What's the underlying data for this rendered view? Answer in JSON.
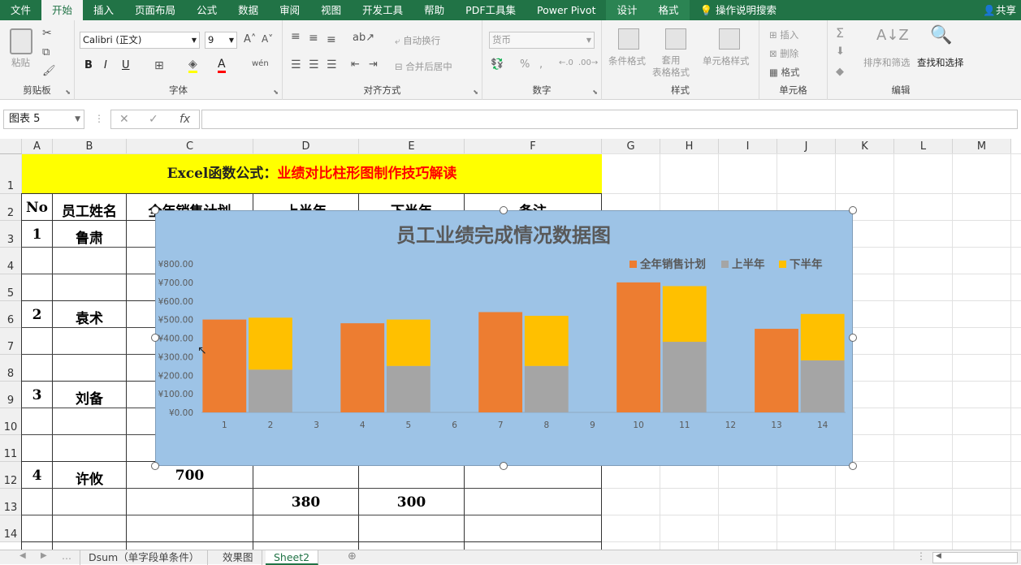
{
  "ribbon_tabs": [
    "文件",
    "开始",
    "插入",
    "页面布局",
    "公式",
    "数据",
    "审阅",
    "视图",
    "开发工具",
    "帮助",
    "PDF工具集",
    "Power Pivot",
    "设计",
    "格式",
    "操作说明搜索"
  ],
  "share": "共享",
  "ribbon": {
    "paste": "粘贴",
    "clipboard": "剪贴板",
    "font_name": "Calibri (正文)",
    "font_size": "9",
    "font_group": "字体",
    "wrap": "自动换行",
    "merge": "合并后居中",
    "align_group": "对齐方式",
    "number_format": "货币",
    "number_group": "数字",
    "cond_format": "条件格式",
    "table_format": "套用\n表格格式",
    "cell_style": "单元格样式",
    "style_group": "样式",
    "insert": "插入",
    "delete": "删除",
    "format": "格式",
    "cells_group": "单元格",
    "sort": "排序和筛选",
    "find": "查找和选择",
    "edit_group": "编辑"
  },
  "namebox": "图表 5",
  "columns": [
    "A",
    "B",
    "C",
    "D",
    "E",
    "F",
    "G",
    "H",
    "I",
    "J",
    "K",
    "L",
    "M"
  ],
  "rows": [
    "1",
    "2",
    "3",
    "4",
    "5",
    "6",
    "7",
    "8",
    "9",
    "10",
    "11",
    "12",
    "13",
    "14"
  ],
  "sheet_title_black": "Excel函数公式：",
  "sheet_title_red": "业绩对比柱形图制作技巧解读",
  "headers": [
    "No",
    "员工姓名",
    "全年销售计划",
    "上半年",
    "下半年",
    "备注"
  ],
  "cells": {
    "r3": {
      "no": "1",
      "name": "鲁肃"
    },
    "r6": {
      "no": "2",
      "name": "袁术"
    },
    "r9": {
      "no": "3",
      "name": "刘备"
    },
    "r12": {
      "no": "4",
      "name": "许攸",
      "plan": "700"
    },
    "r13": {
      "h1": "380",
      "h2": "300"
    }
  },
  "chart_data": {
    "type": "bar",
    "title": "员工业绩完成情况数据图",
    "legend_position": "top-right",
    "categories": [
      "1",
      "2",
      "3",
      "4",
      "5",
      "6",
      "7",
      "8",
      "9",
      "10",
      "11",
      "12",
      "13",
      "14"
    ],
    "y_ticks": [
      "¥0.00",
      "¥100.00",
      "¥200.00",
      "¥300.00",
      "¥400.00",
      "¥500.00",
      "¥600.00",
      "¥700.00",
      "¥800.00"
    ],
    "ylim": [
      0,
      800
    ],
    "series": [
      {
        "name": "全年销售计划",
        "color": "#ed7d31",
        "values": [
          500,
          null,
          null,
          480,
          null,
          null,
          540,
          null,
          null,
          700,
          null,
          null,
          450,
          null
        ]
      },
      {
        "name": "上半年",
        "color": "#a5a5a5",
        "values": [
          null,
          230,
          null,
          null,
          250,
          null,
          null,
          250,
          null,
          null,
          380,
          null,
          null,
          280
        ]
      },
      {
        "name": "下半年",
        "color": "#ffc000",
        "values": [
          null,
          280,
          null,
          null,
          250,
          null,
          null,
          270,
          null,
          null,
          300,
          null,
          null,
          250
        ]
      }
    ]
  },
  "sheet_tabs": [
    "Dsum（单字段单条件）",
    "效果图",
    "Sheet2"
  ],
  "active_sheet": "Sheet2"
}
